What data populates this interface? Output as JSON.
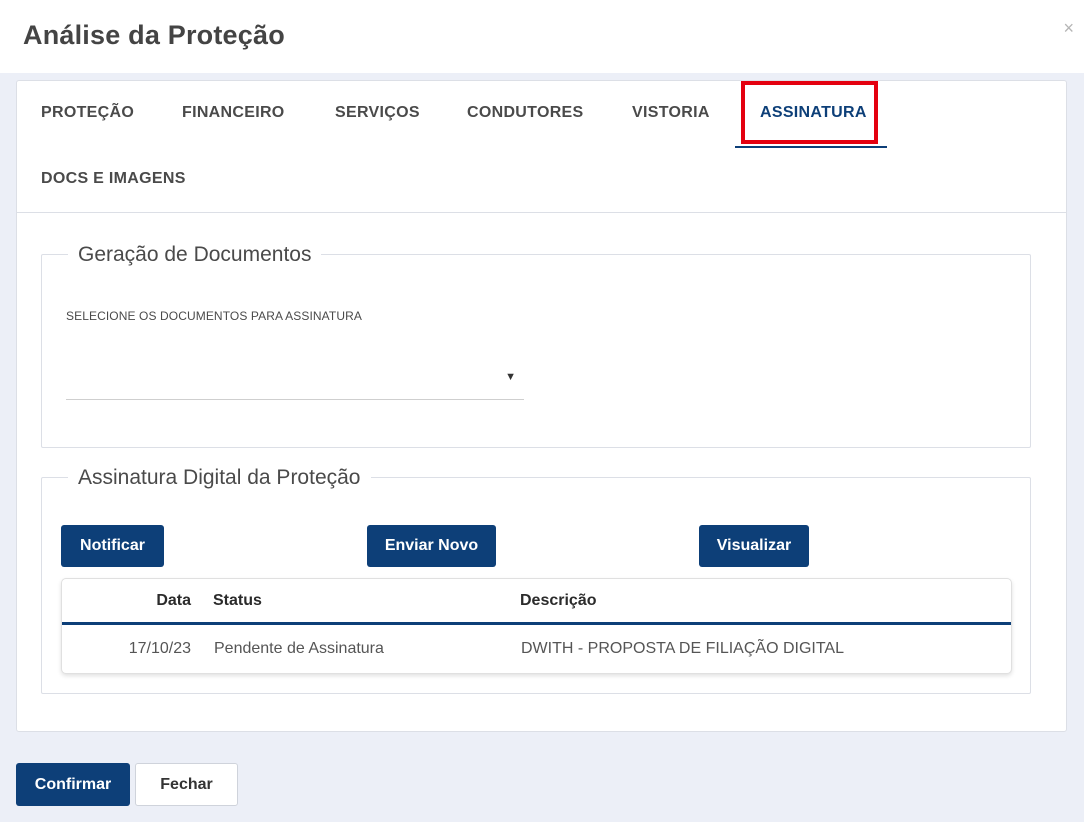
{
  "modal": {
    "title": "Análise da Proteção",
    "close_icon": "×"
  },
  "tabs": [
    {
      "label": "PROTEÇÃO",
      "active": false
    },
    {
      "label": "FINANCEIRO",
      "active": false
    },
    {
      "label": "SERVIÇOS",
      "active": false
    },
    {
      "label": "CONDUTORES",
      "active": false
    },
    {
      "label": "VISTORIA",
      "active": false
    },
    {
      "label": "ASSINATURA",
      "active": true
    },
    {
      "label": "DOCS E IMAGENS",
      "active": false
    }
  ],
  "geracao": {
    "legend": "Geração de Documentos",
    "select_label": "SELECIONE OS DOCUMENTOS PARA ASSINATURA",
    "select_value": "",
    "select_arrow": "▼"
  },
  "assinatura": {
    "legend": "Assinatura Digital da Proteção",
    "buttons": {
      "notificar": "Notificar",
      "enviar_novo": "Enviar Novo",
      "visualizar": "Visualizar"
    },
    "table": {
      "headers": {
        "data": "Data",
        "status": "Status",
        "descricao": "Descrição"
      },
      "rows": [
        {
          "data": "17/10/23",
          "status": "Pendente de Assinatura",
          "descricao": "DWITH - PROPOSTA DE FILIAÇÃO DIGITAL"
        }
      ]
    }
  },
  "footer": {
    "confirm_label": "Confirmar",
    "close_label": "Fechar"
  },
  "colors": {
    "primary": "#0d3f78",
    "highlight": "#e4000f",
    "page_bg": "#eceff7"
  }
}
